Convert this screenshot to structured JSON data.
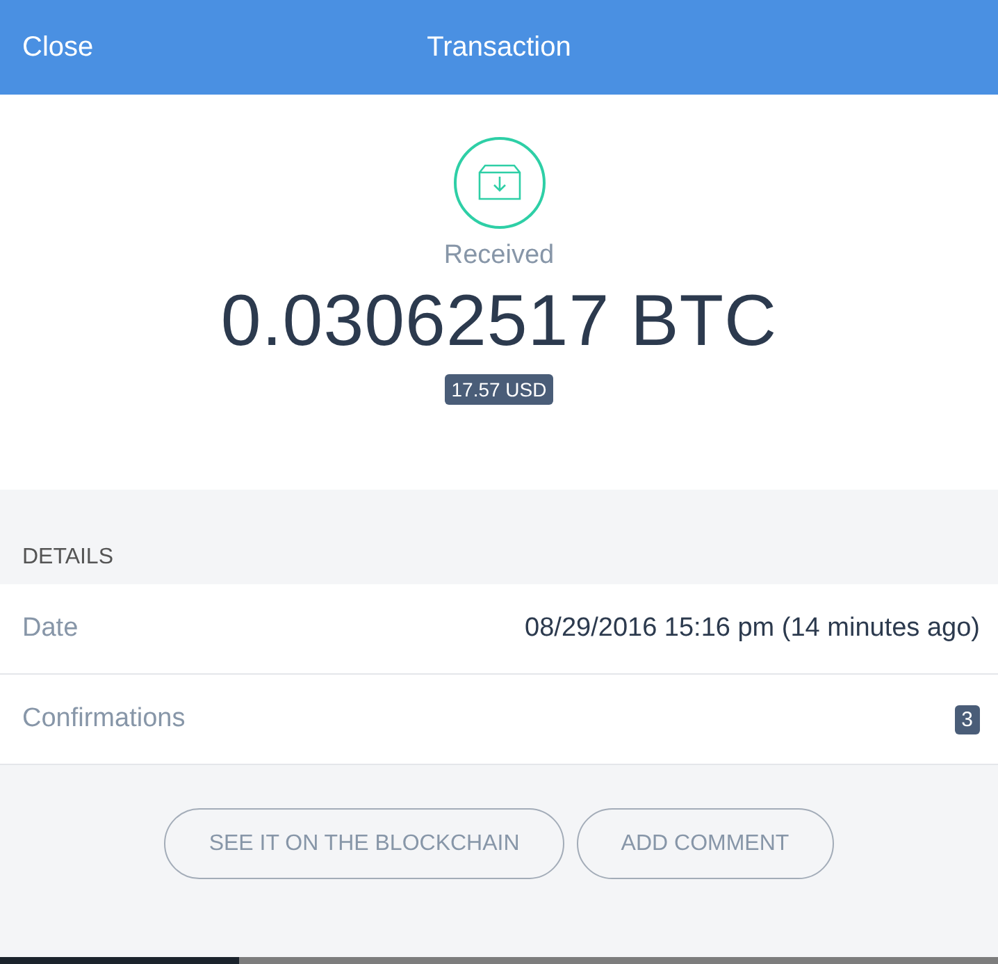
{
  "header": {
    "close": "Close",
    "title": "Transaction"
  },
  "summary": {
    "direction": "Received",
    "amount": "0.03062517 BTC",
    "fiat": "17.57 USD"
  },
  "details": {
    "heading": "DETAILS",
    "rows": [
      {
        "kind": "text",
        "label": "Date",
        "value": "08/29/2016 15:16 pm (14 minutes ago)"
      },
      {
        "kind": "badge",
        "label": "Confirmations",
        "value": "3"
      }
    ]
  },
  "buttons": [
    "SEE IT ON THE BLOCKCHAIN",
    "ADD COMMENT"
  ]
}
